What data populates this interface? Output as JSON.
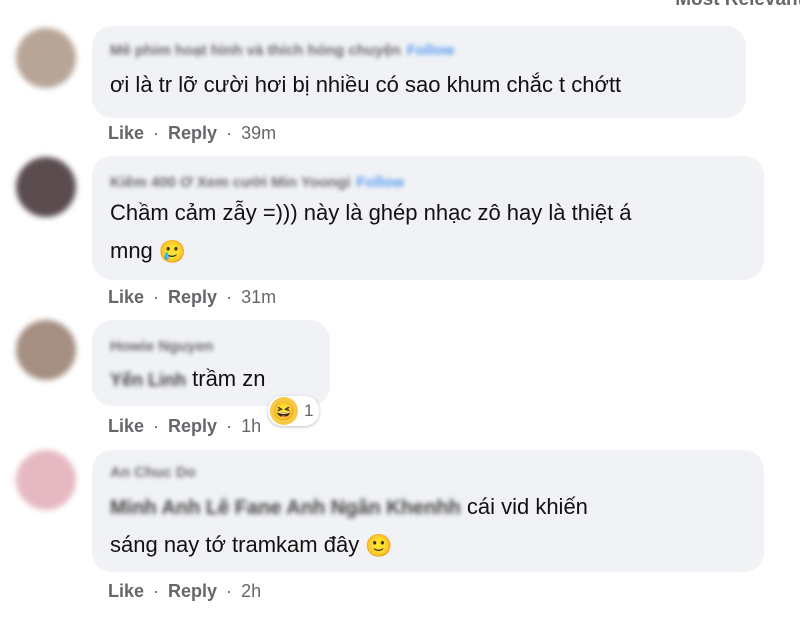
{
  "sort_label": "Most Relevant",
  "comments": [
    {
      "name": "Mê phim hoạt hình và thích hóng chuyện",
      "follow": "Follow",
      "text": "ơi là tr lỡ cười hơi bị nhiều có sao khum chắc t chớtt",
      "like": "Like",
      "reply": "Reply",
      "time": "39m",
      "avatar_color": "#b7a597"
    },
    {
      "name": "Kiêm 400 Ơ Xem cười Min Yoongi",
      "follow": "Follow",
      "text_line1": "Chầm cảm zẫy =))) này là ghép nhạc zô hay là thiệt á",
      "text_line2": "mng",
      "emoji": "🥲",
      "like": "Like",
      "reply": "Reply",
      "time": "31m",
      "avatar_color": "#5b4c4f"
    },
    {
      "name": "Howie Nguyen",
      "mention": "Yến Linh",
      "text": "trầm zn",
      "reaction_emoji": "😆",
      "reaction_count": "1",
      "like": "Like",
      "reply": "Reply",
      "time": "1h",
      "avatar_color": "#a58f82"
    },
    {
      "name": "An Chuc Do",
      "mention": "Minh Anh Lê Fane Anh Ngân Khenhh",
      "text_line1": "cái vid khiến",
      "text_line2": "sáng nay tớ tramkam đây",
      "emoji": "🙂",
      "like": "Like",
      "reply": "Reply",
      "time": "2h",
      "avatar_color": "#e6b9c2"
    }
  ]
}
